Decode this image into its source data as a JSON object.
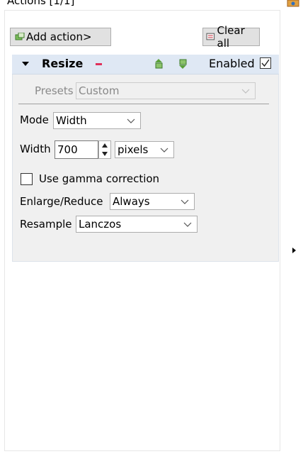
{
  "panel": {
    "title": "Actions [1/1]"
  },
  "toolbar": {
    "add_label": "Add action>",
    "clear_label": "Clear all"
  },
  "action": {
    "name": "Resize",
    "enabled_label": "Enabled",
    "enabled": true
  },
  "presets": {
    "label": "Presets",
    "value": "Custom"
  },
  "mode": {
    "label": "Mode",
    "value": "Width"
  },
  "width": {
    "label": "Width",
    "value": "700",
    "unit": "pixels"
  },
  "gamma": {
    "label": "Use gamma correction",
    "checked": false
  },
  "enlarge": {
    "label": "Enlarge/Reduce",
    "value": "Always"
  },
  "resample": {
    "label": "Resample",
    "value": "Lanczos"
  },
  "icons": {
    "add": "add-action-icon",
    "clear": "clear-all-icon",
    "remove": "remove-icon",
    "up": "move-up-icon",
    "down": "move-down-icon"
  }
}
